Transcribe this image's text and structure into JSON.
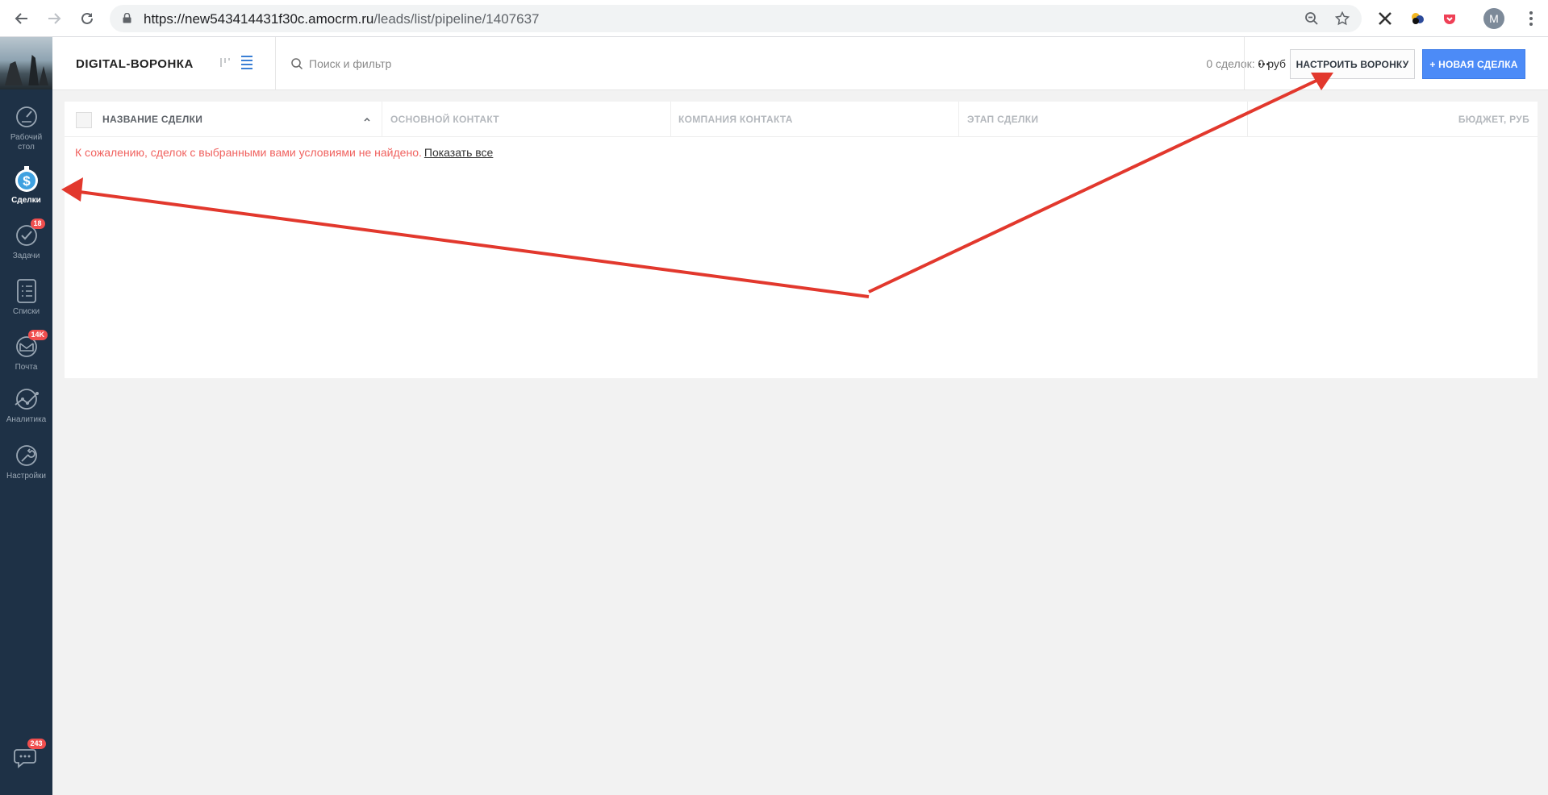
{
  "browser": {
    "url_host": "https://new543414431f30c.amocrm.ru",
    "url_path": "/leads/list/pipeline/1407637",
    "profile_initial": "M"
  },
  "sidebar": {
    "items": [
      {
        "label": "Рабочий стол",
        "icon": "dashboard-icon"
      },
      {
        "label": "Сделки",
        "icon": "deals-dollar-icon",
        "active": true
      },
      {
        "label": "Задачи",
        "icon": "tasks-check-icon",
        "badge": "18"
      },
      {
        "label": "Списки",
        "icon": "lists-icon"
      },
      {
        "label": "Почта",
        "icon": "mail-icon",
        "badge": "14K"
      },
      {
        "label": "Аналитика",
        "icon": "analytics-icon"
      },
      {
        "label": "Настройки",
        "icon": "settings-wrench-icon"
      }
    ],
    "chat_badge": "243"
  },
  "topbar": {
    "pipeline_title": "DIGITAL-ВОРОНКА",
    "search_placeholder": "Поиск и фильтр",
    "deals_count_label": "0 сделок:",
    "deals_sum": "0 руб",
    "setup_button": "НАСТРОИТЬ ВОРОНКУ",
    "new_deal_button": "+ НОВАЯ СДЕЛКА"
  },
  "table": {
    "columns": [
      "НАЗВАНИЕ СДЕЛКИ",
      "ОСНОВНОЙ КОНТАКТ",
      "КОМПАНИЯ КОНТАКТА",
      "ЭТАП СДЕЛКИ",
      "БЮДЖЕТ, РУБ"
    ],
    "empty_message": "К сожалению, сделок с выбранными вами условиями не найдено.",
    "show_all_link": "Показать все"
  },
  "colors": {
    "sidebar_bg": "#1e3146",
    "accent_blue": "#4c8bf7",
    "error_text": "#f0625f",
    "badge_red": "#f04e4e",
    "annotation_red": "#e2382d"
  }
}
